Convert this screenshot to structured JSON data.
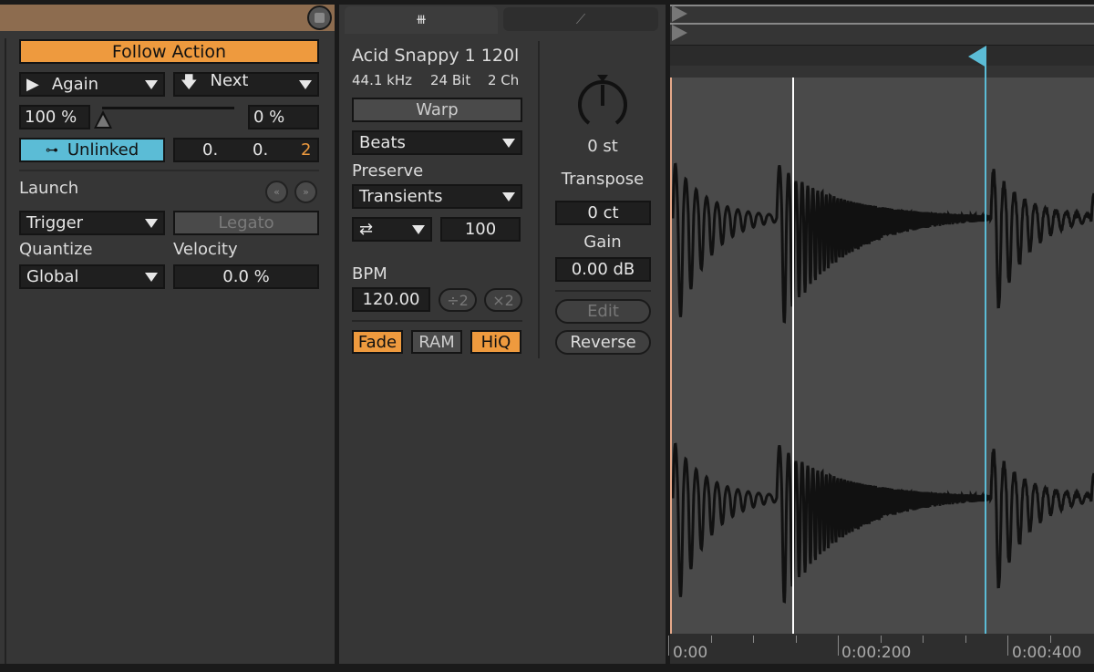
{
  "colors": {
    "accent_orange": "#ee9a3e",
    "accent_blue": "#5bbcd6",
    "header_brown": "#8d6c4f",
    "panel": "#363636",
    "waveform_bg": "#4a4a4a"
  },
  "clip": {
    "save_icon": "floppy-disk-icon"
  },
  "follow_action": {
    "title": "Follow Action",
    "action_a": {
      "icon": "play-icon",
      "label": "Again"
    },
    "action_b": {
      "icon": "arrow-down-icon",
      "label": "Next"
    },
    "chance_a": "100 %",
    "chance_b": "0 %",
    "chance_fraction": 1.0,
    "link_label": "Unlinked",
    "link_icon": "link-icon",
    "time": {
      "bars": "0.",
      "beats": "0.",
      "sixteenths": "2"
    }
  },
  "launch": {
    "title": "Launch",
    "prev_icon": "rewind-icon",
    "next_icon": "fast-forward-icon",
    "mode": "Trigger",
    "legato": "Legato",
    "quantize_label": "Quantize",
    "quantize": "Global",
    "velocity_label": "Velocity",
    "velocity": "0.0 %"
  },
  "tabs": [
    {
      "icon": "waveform-icon",
      "active": true
    },
    {
      "icon": "envelope-icon",
      "active": false
    }
  ],
  "sample": {
    "name": "Acid Snappy 1 120l",
    "rate": "44.1 kHz",
    "bits": "24 Bit",
    "channels": "2 Ch",
    "warp": "Warp",
    "warp_mode": "Beats",
    "preserve_label": "Preserve",
    "preserve": "Transients",
    "loop_mode_icon": "loop-swap-icon",
    "envelope": "100",
    "bpm_label": "BPM",
    "bpm": "120.00",
    "half": "÷2",
    "double": "×2",
    "fade": "Fade",
    "ram": "RAM",
    "hiq": "HiQ",
    "transpose_value": "0 st",
    "transpose_label": "Transpose",
    "detune": "0 ct",
    "gain_label": "Gain",
    "gain": "0.00 dB",
    "edit": "Edit",
    "reverse": "Reverse"
  },
  "timeline": {
    "ticks": [
      "0:00",
      "0:00:200",
      "0:00:400"
    ]
  }
}
